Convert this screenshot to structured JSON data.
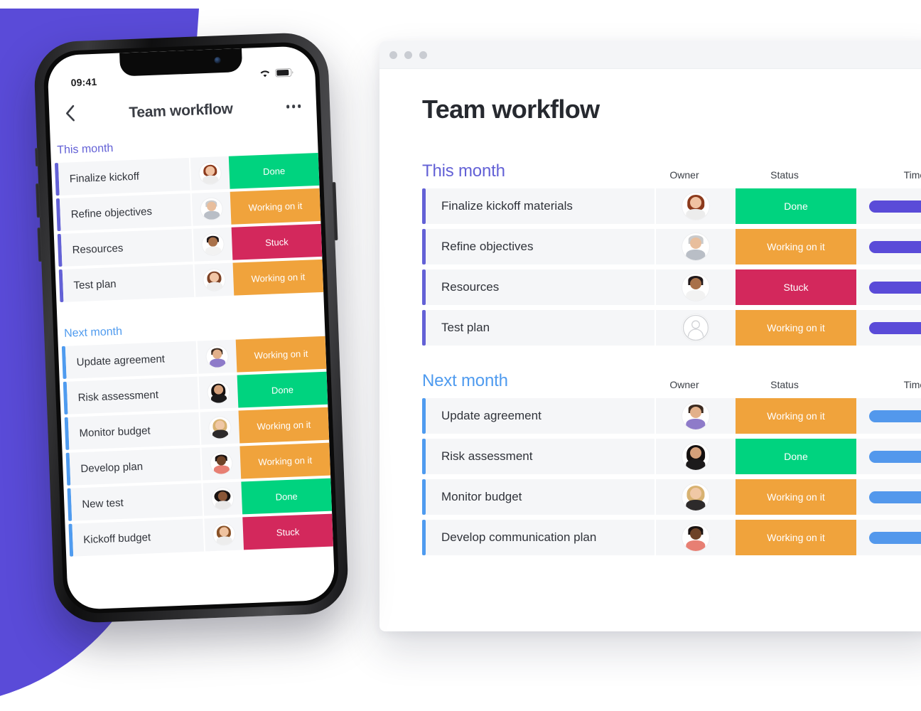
{
  "colors": {
    "brand_purple": "#5A4BD8",
    "group_purple": "#6361D6",
    "group_blue": "#4F9BEF",
    "status_done": "#00D37F",
    "status_working": "#F0A33C",
    "status_stuck": "#D3285C",
    "timeline_purple": "#5A4BD8",
    "timeline_blue": "#5398EC",
    "row_bg": "#F5F6F8"
  },
  "phone": {
    "status_bar": {
      "time": "09:41",
      "wifi_icon": "wifi-icon",
      "battery_icon": "battery-icon"
    },
    "nav": {
      "back_icon": "chevron-left-icon",
      "title": "Team workflow",
      "more_icon": "more-options-icon"
    },
    "groups": [
      {
        "title": "This month",
        "accent": "purple",
        "rows": [
          {
            "name": "Finalize kickoff",
            "status": "Done",
            "status_color": "#00D37F",
            "avatar": "woman-red-hair"
          },
          {
            "name": "Refine objectives",
            "status": "Working on it",
            "status_color": "#F0A33C",
            "avatar": "man-glasses-beard"
          },
          {
            "name": "Resources",
            "status": "Stuck",
            "status_color": "#D3285C",
            "avatar": "man-dark-beard"
          },
          {
            "name": "Test plan",
            "status": "Working on it",
            "status_color": "#F0A33C",
            "avatar": "woman-long-hair"
          }
        ]
      },
      {
        "title": "Next month",
        "accent": "blue",
        "rows": [
          {
            "name": "Update agreement",
            "status": "Working on it",
            "status_color": "#F0A33C",
            "avatar": "man-smiling"
          },
          {
            "name": "Risk assessment",
            "status": "Done",
            "status_color": "#00D37F",
            "avatar": "woman-black-hair"
          },
          {
            "name": "Monitor budget",
            "status": "Working on it",
            "status_color": "#F0A33C",
            "avatar": "woman-blonde"
          },
          {
            "name": "Develop plan",
            "status": "Working on it",
            "status_color": "#F0A33C",
            "avatar": "man-short-hair"
          },
          {
            "name": "New test",
            "status": "Done",
            "status_color": "#00D37F",
            "avatar": "woman-curly-hair"
          },
          {
            "name": "Kickoff budget",
            "status": "Stuck",
            "status_color": "#D3285C",
            "avatar": "woman-wavy-hair"
          }
        ]
      }
    ]
  },
  "desktop": {
    "window_controls": [
      "close-dot",
      "minimize-dot",
      "maximize-dot"
    ],
    "title": "Team workflow",
    "columns": [
      "Owner",
      "Status",
      "Timeline"
    ],
    "groups": [
      {
        "title": "This month",
        "accent": "purple",
        "timeline_color": "#5A4BD8",
        "rows": [
          {
            "name": "Finalize kickoff materials",
            "status": "Done",
            "status_color": "#00D37F",
            "avatar": "woman-red-hair",
            "timeline_width": 100
          },
          {
            "name": "Refine objectives",
            "status": "Working on it",
            "status_color": "#F0A33C",
            "avatar": "man-glasses-beard",
            "timeline_width": 83
          },
          {
            "name": "Resources",
            "status": "Stuck",
            "status_color": "#D3285C",
            "avatar": "man-dark-beard",
            "timeline_width": 100
          },
          {
            "name": "Test plan",
            "status": "Working on it",
            "status_color": "#F0A33C",
            "avatar": "placeholder-person",
            "timeline_width": 100
          }
        ]
      },
      {
        "title": "Next month",
        "accent": "blue",
        "timeline_color": "#5398EC",
        "rows": [
          {
            "name": "Update agreement",
            "status": "Working on it",
            "status_color": "#F0A33C",
            "avatar": "man-smiling",
            "timeline_width": 100
          },
          {
            "name": "Risk assessment",
            "status": "Done",
            "status_color": "#00D37F",
            "avatar": "woman-black-hair",
            "timeline_width": 80
          },
          {
            "name": "Monitor budget",
            "status": "Working on it",
            "status_color": "#F0A33C",
            "avatar": "woman-blonde",
            "timeline_width": 100
          },
          {
            "name": "Develop communication plan",
            "status": "Working on it",
            "status_color": "#F0A33C",
            "avatar": "man-short-hair",
            "timeline_width": 100
          }
        ]
      }
    ]
  }
}
